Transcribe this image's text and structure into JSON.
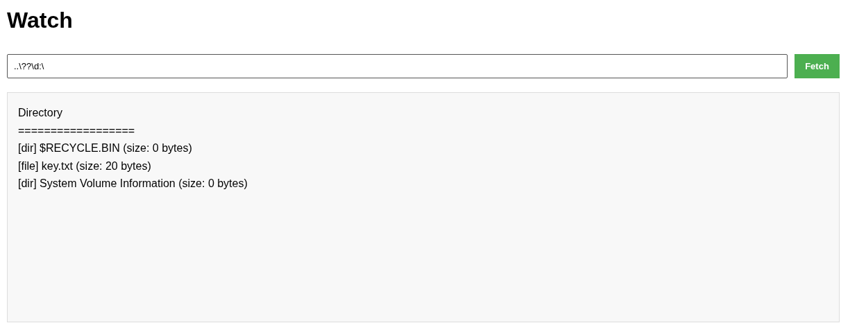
{
  "title": "Watch",
  "path_field": {
    "value": "..\\??\\d:\\"
  },
  "fetch_button": {
    "label": "Fetch"
  },
  "output": {
    "lines": [
      "Directory",
      "==================",
      "[dir] $RECYCLE.BIN (size: 0 bytes)",
      "[file] key.txt (size: 20 bytes)",
      "[dir] System Volume Information (size: 0 bytes)"
    ]
  }
}
